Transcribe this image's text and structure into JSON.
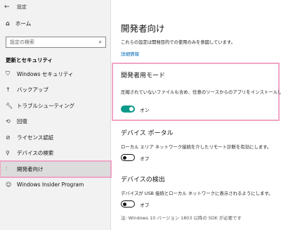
{
  "window": {
    "title": "設定"
  },
  "sidebar": {
    "home_label": "ホーム",
    "search_placeholder": "設定の検索",
    "section_title": "更新とセキュリティ",
    "items": [
      {
        "label": "Windows セキュリティ",
        "icon": "shield-icon"
      },
      {
        "label": "バックアップ",
        "icon": "backup-arrow-icon"
      },
      {
        "label": "トラブルシューティング",
        "icon": "wrench-icon"
      },
      {
        "label": "回復",
        "icon": "recovery-icon"
      },
      {
        "label": "ライセンス認証",
        "icon": "check-circle-icon"
      },
      {
        "label": "デバイスの検索",
        "icon": "person-search-icon"
      },
      {
        "label": "開発者向け",
        "icon": "developer-tools-icon",
        "active": true
      },
      {
        "label": "Windows Insider Program",
        "icon": "insider-icon"
      }
    ]
  },
  "main": {
    "title": "開発者向け",
    "description": "これらの設定は開発目的での使用のみを意図しています。",
    "link": "詳細情報",
    "dev_mode": {
      "heading": "開発者用モード",
      "description": "圧縮されていないファイルも含め、任意のソースからのアプリをインストールしま",
      "toggle_on": true,
      "toggle_label": "オン"
    },
    "device_portal": {
      "heading": "デバイス ポータル",
      "description": "ローカル エリア ネットワーク接続を介したリモート診断を有効にします。",
      "toggle_on": false,
      "toggle_label": "オフ"
    },
    "device_discovery": {
      "heading": "デバイスの検出",
      "description": "デバイスが USB 接続とローカル ネットワークに表示されるようにします。",
      "toggle_on": false,
      "toggle_label": "オフ",
      "note": "注: Windows 10 バージョン 1803 以降の SDK が必要です"
    }
  },
  "colors": {
    "accent": "#0a9a8a",
    "highlight": "#f0a4c4",
    "link": "#0066b4"
  }
}
